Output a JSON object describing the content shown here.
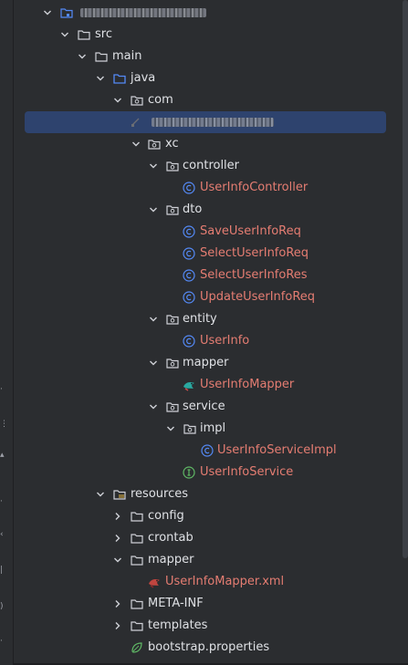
{
  "tree": {
    "project_name_redacted": true,
    "rows": [
      {
        "label": "",
        "kind": "module",
        "blur": true
      },
      {
        "label": "src",
        "kind": "folder"
      },
      {
        "label": "main",
        "kind": "folder"
      },
      {
        "label": "java",
        "kind": "source-folder"
      },
      {
        "label": "com",
        "kind": "package"
      },
      {
        "label": "",
        "kind": "package-redacted",
        "blur": true,
        "selected": true
      },
      {
        "label": "xc",
        "kind": "package"
      },
      {
        "label": "controller",
        "kind": "package"
      },
      {
        "label": "UserInfoController",
        "kind": "class"
      },
      {
        "label": "dto",
        "kind": "package"
      },
      {
        "label": "SaveUserInfoReq",
        "kind": "class"
      },
      {
        "label": "SelectUserInfoReq",
        "kind": "class"
      },
      {
        "label": "SelectUserInfoRes",
        "kind": "class"
      },
      {
        "label": "UpdateUserInfoReq",
        "kind": "class"
      },
      {
        "label": "entity",
        "kind": "package"
      },
      {
        "label": "UserInfo",
        "kind": "class"
      },
      {
        "label": "mapper",
        "kind": "package"
      },
      {
        "label": "UserInfoMapper",
        "kind": "mybatis-mapper"
      },
      {
        "label": "service",
        "kind": "package"
      },
      {
        "label": "impl",
        "kind": "package"
      },
      {
        "label": "UserInfoServiceImpl",
        "kind": "class"
      },
      {
        "label": "UserInfoService",
        "kind": "interface"
      },
      {
        "label": "resources",
        "kind": "resources-folder"
      },
      {
        "label": "config",
        "kind": "folder"
      },
      {
        "label": "crontab",
        "kind": "folder"
      },
      {
        "label": "mapper",
        "kind": "folder"
      },
      {
        "label": "UserInfoMapper.xml",
        "kind": "mybatis-xml"
      },
      {
        "label": "META-INF",
        "kind": "folder"
      },
      {
        "label": "templates",
        "kind": "folder"
      },
      {
        "label": "bootstrap.properties",
        "kind": "properties"
      }
    ]
  },
  "colors": {
    "background": "#2b2d30",
    "selection": "#2e436e",
    "text": "#dfe1e5",
    "class_text": "#e57d72",
    "class_icon": "#548af7",
    "interface_icon": "#5fb865",
    "source_folder_icon": "#548af7"
  }
}
